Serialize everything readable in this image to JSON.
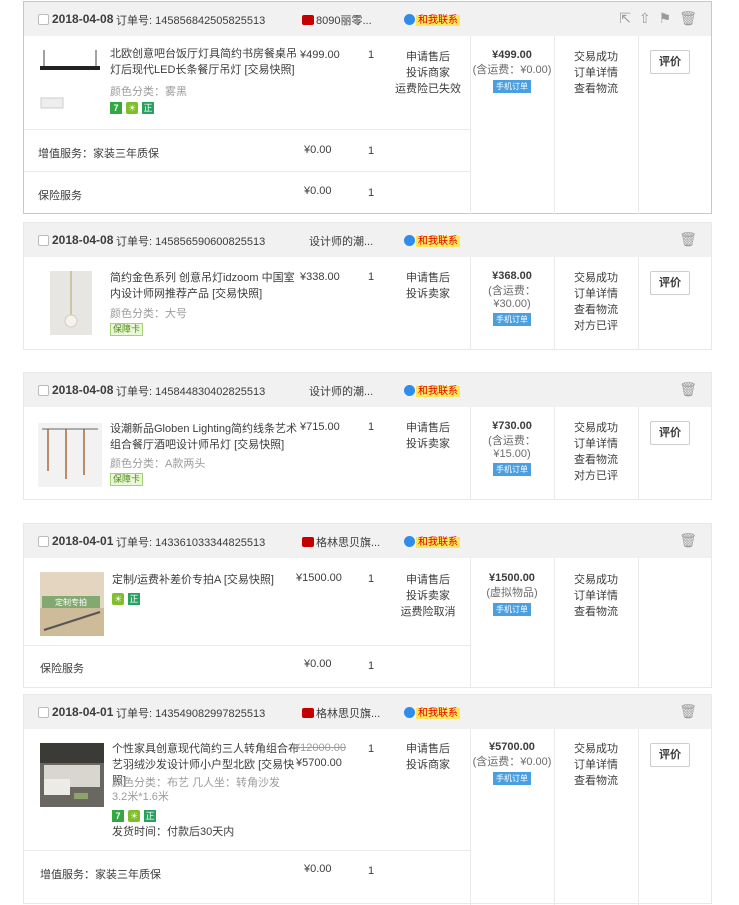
{
  "ui": {
    "rate_label": "评价",
    "order_no_label": "订单号: ",
    "mobile_label": "手机订单",
    "contact_label": "和我联系",
    "badge_7": "7",
    "badge_zheng": "正",
    "badge_baozhang": "保障卡",
    "qty": "1"
  },
  "orders": [
    {
      "date": "2018-04-08",
      "order_no": "145856842505825513",
      "shop": "8090丽零...",
      "tmall": true,
      "item": {
        "name": "北欧创意吧台饭厅灯具简约书房餐桌吊灯后现代LED长条餐厅吊灯",
        "snapshot": "[交易快照]",
        "attr": "颜色分类：雾黑",
        "price": "¥499.00",
        "services": [
          "申请售后",
          "投诉商家",
          "运费险已失效"
        ]
      },
      "total": "¥499.00",
      "shipping": "(含运费：¥0.00)",
      "status": [
        "交易成功",
        "订单详情",
        "查看物流"
      ],
      "extras": [
        {
          "label": "增值服务：家装三年质保",
          "price": "¥0.00"
        },
        {
          "label": "保险服务",
          "price": "¥0.00"
        }
      ]
    },
    {
      "date": "2018-04-08",
      "order_no": "145856590600825513",
      "shop": "设计师的潮...",
      "tmall": false,
      "item": {
        "name": "简约金色系列 创意吊灯idzoom 中国室内设计师网推荐产品",
        "snapshot": "[交易快照]",
        "attr": "颜色分类：大号",
        "price": "¥338.00",
        "services": [
          "申请售后",
          "投诉卖家"
        ]
      },
      "total": "¥368.00",
      "shipping": "(含运费：¥30.00)",
      "status": [
        "交易成功",
        "订单详情",
        "查看物流",
        "对方已评"
      ]
    },
    {
      "date": "2018-04-08",
      "order_no": "145844830402825513",
      "shop": "设计师的潮...",
      "tmall": false,
      "item": {
        "name": "设潮新品Globen Lighting简约线条艺术组合餐厅酒吧设计师吊灯",
        "snapshot": "[交易快照]",
        "attr": "颜色分类：A款两头",
        "price": "¥715.00",
        "services": [
          "申请售后",
          "投诉卖家"
        ]
      },
      "total": "¥730.00",
      "shipping": "(含运费：¥15.00)",
      "status": [
        "交易成功",
        "订单详情",
        "查看物流",
        "对方已评"
      ]
    },
    {
      "date": "2018-04-01",
      "order_no": "143361033344825513",
      "shop": "格林思贝旗...",
      "tmall": true,
      "item": {
        "name": "定制/运费补差价专拍A",
        "snapshot": "[交易快照]",
        "price": "¥1500.00",
        "services": [
          "申请售后",
          "投诉卖家",
          "运费险取消"
        ],
        "thumb_text": "定制专拍"
      },
      "total": "¥1500.00",
      "shipping": "(虚拟物品)",
      "status": [
        "交易成功",
        "订单详情",
        "查看物流"
      ],
      "extras": [
        {
          "label": "保险服务",
          "price": "¥0.00"
        }
      ]
    },
    {
      "date": "2018-04-01",
      "order_no": "143549082997825513",
      "shop": "格林思贝旗...",
      "tmall": true,
      "item": {
        "name": "个性家具创意现代简约三人转角组合布艺羽绒沙发设计师小户型北欧",
        "snapshot": "[交易快照]",
        "attr": "颜色分类：布艺  几人坐：转角沙发3.2米*1.6米",
        "old_price": "¥12000.00",
        "price": "¥5700.00",
        "services": [
          "申请售后",
          "投诉商家"
        ],
        "delivery": "发货时间：付款后30天内"
      },
      "total": "¥5700.00",
      "shipping": "(含运费：¥0.00)",
      "status": [
        "交易成功",
        "订单详情",
        "查看物流"
      ],
      "extras": [
        {
          "label": "增值服务：家装三年质保",
          "price": "¥0.00"
        }
      ]
    }
  ]
}
